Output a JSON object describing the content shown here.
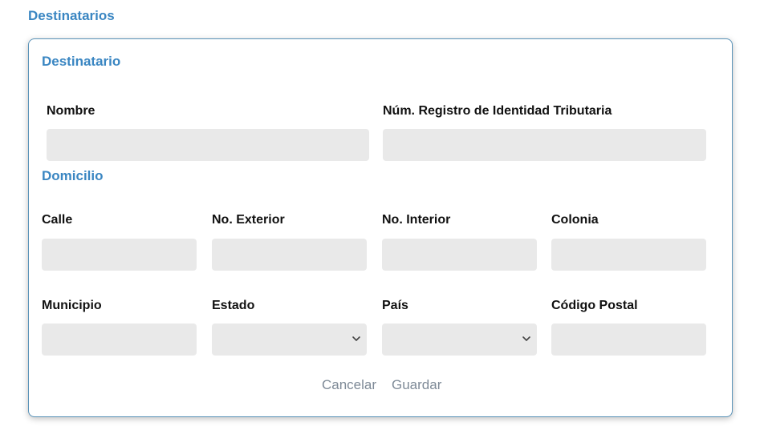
{
  "section_title": "Destinatarios",
  "card": {
    "title": "Destinatario",
    "nombre_label": "Nombre",
    "nombre_value": "",
    "registro_label": "Núm. Registro de Identidad Tributaria",
    "registro_value": "",
    "domicilio_title": "Domicilio",
    "calle_label": "Calle",
    "calle_value": "",
    "no_exterior_label": "No. Exterior",
    "no_exterior_value": "",
    "no_interior_label": "No. Interior",
    "no_interior_value": "",
    "colonia_label": "Colonia",
    "colonia_value": "",
    "municipio_label": "Municipio",
    "municipio_value": "",
    "estado_label": "Estado",
    "estado_value": "",
    "pais_label": "País",
    "pais_value": "",
    "codigo_postal_label": "Código Postal",
    "codigo_postal_value": "",
    "cancel_label": "Cancelar",
    "save_label": "Guardar"
  },
  "colors": {
    "accent": "#3a86c2",
    "input_bg": "#e9e9e9",
    "button_text": "#7e8a97",
    "card_border": "#5a93b8"
  },
  "icons": {
    "select_arrow": "chevron-down-icon"
  }
}
